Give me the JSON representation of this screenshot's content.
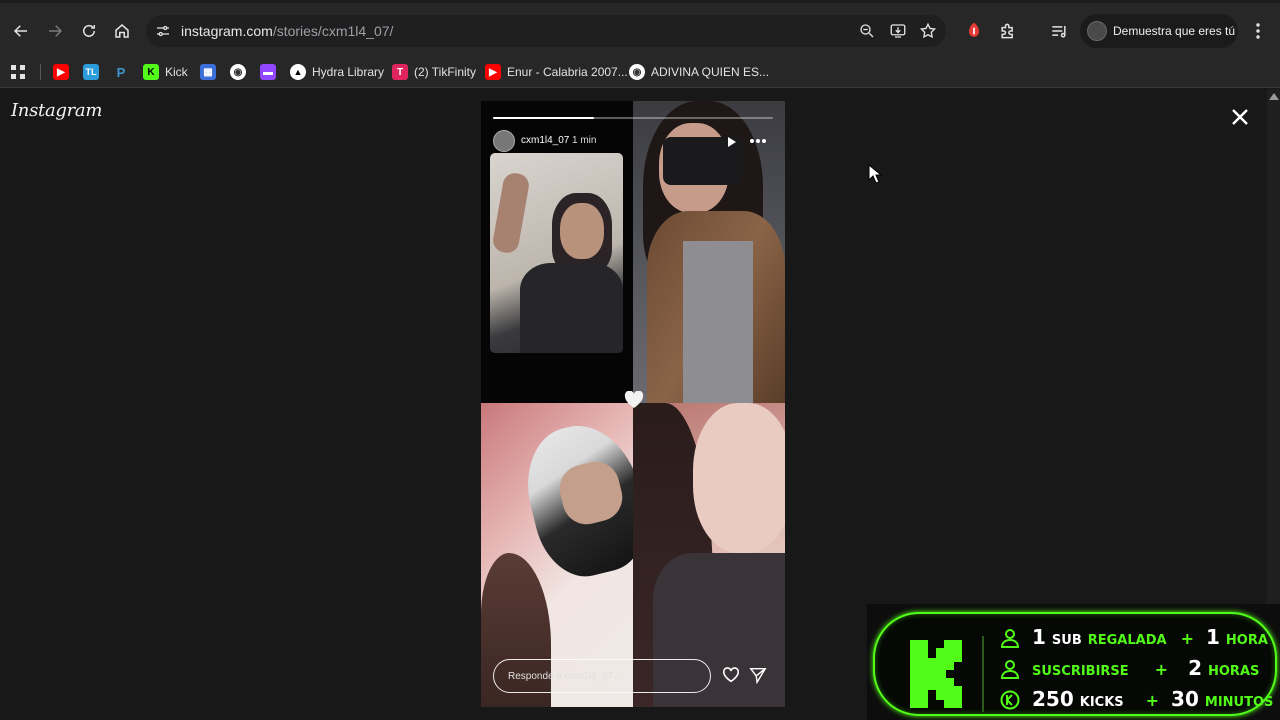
{
  "browser": {
    "url_host": "instagram.com",
    "url_path": "/stories/cxm1l4_07/",
    "profile_label": "Demuestra que eres tú"
  },
  "bookmarks": [
    {
      "label": "",
      "icon": "youtube-icon",
      "color": "#ff0000"
    },
    {
      "label": "",
      "icon": "tl-icon",
      "color": "#2d9cdb",
      "glyph": "TL"
    },
    {
      "label": "",
      "icon": "paypal-icon",
      "color": "#0070ba",
      "glyph": "P"
    },
    {
      "label": "Kick",
      "icon": "kick-icon",
      "color": "#53fc18",
      "glyph": "K"
    },
    {
      "label": "",
      "icon": "app-icon",
      "color": "#3b6fd9",
      "glyph": ""
    },
    {
      "label": "",
      "icon": "globe-icon",
      "color": "#ffffff",
      "glyph": ""
    },
    {
      "label": "",
      "icon": "twitch-icon",
      "color": "#9146ff",
      "glyph": ""
    },
    {
      "label": "Hydra Library",
      "icon": "hydra-icon",
      "color": "#ffffff",
      "glyph": ""
    },
    {
      "label": "(2) TikFinity",
      "icon": "tikfinity-icon",
      "color": "#e0245e",
      "glyph": "T"
    },
    {
      "label": "Enur - Calabria 2007...",
      "icon": "youtube-icon",
      "color": "#ff0000"
    },
    {
      "label": "ADIVINA QUIEN ES...",
      "icon": "globe-icon",
      "color": "#ffffff",
      "glyph": ""
    }
  ],
  "instagram": {
    "logo": "Instagram"
  },
  "story": {
    "username": "cxm1l4_07",
    "time": "1 min",
    "progress": 0.36,
    "reply_placeholder": "Responde a cxm1l4_07..."
  },
  "kick_overlay": {
    "accent": "#53fc18",
    "rows": [
      {
        "icon": "user-icon",
        "num": "1",
        "word": "SUB",
        "green": "REGALADA",
        "plus": "+",
        "num2": "1",
        "unit": "HORA"
      },
      {
        "icon": "user-icon",
        "num": "",
        "word": "",
        "green": "SUSCRIBIRSE",
        "plus": "+",
        "num2": "2",
        "unit": "HORAS"
      },
      {
        "icon": "kick-coin-icon",
        "num": "250",
        "word": "KICKS",
        "green": "",
        "plus": "+",
        "num2": "30",
        "unit": "MINUTOS"
      }
    ]
  }
}
